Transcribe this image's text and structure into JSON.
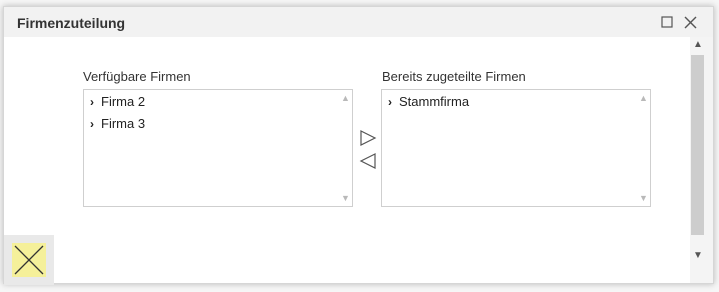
{
  "dialog": {
    "title": "Firmenzuteilung",
    "maximize_icon": "maximize-icon",
    "close_icon": "close-icon"
  },
  "available": {
    "label": "Verfügbare Firmen",
    "items": [
      {
        "label": "Firma 2"
      },
      {
        "label": "Firma 3"
      }
    ]
  },
  "assigned": {
    "label": "Bereits zugeteilte Firmen",
    "items": [
      {
        "label": "Stammfirma"
      }
    ]
  },
  "controls": {
    "add_icon": "triangle-right-icon",
    "remove_icon": "triangle-left-icon"
  },
  "footer": {
    "cancel_icon": "x-icon",
    "cancel_color": "#f5f09a"
  },
  "colors": {
    "titlebar_bg": "#f2f2f2",
    "accent_yellow": "#f5f09a"
  }
}
